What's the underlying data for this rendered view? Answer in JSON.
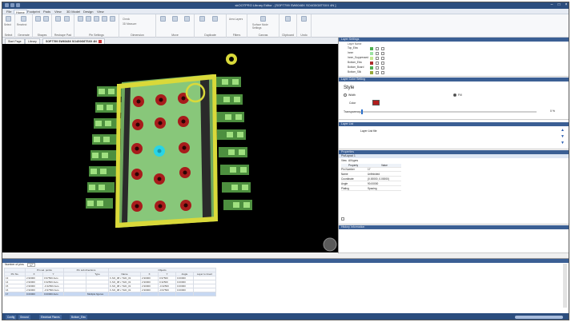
{
  "window": {
    "title": "skOOTPRO Library Editor - [SOP7799 SW6048X SO4G0G8TSXX 4N ]",
    "min_glyph": "–",
    "max_glyph": "□",
    "close_glyph": "×"
  },
  "menubar": {
    "items": [
      "File",
      "Home",
      "Footprint",
      "Pads",
      "View",
      "3D Model",
      "Design",
      "View"
    ]
  },
  "ribbon": {
    "groups": [
      {
        "label": "Select",
        "items": [
          "Select",
          "Reselect"
        ]
      },
      {
        "label": "Generate",
        "items": []
      },
      {
        "label": "Shapes",
        "items": [
          "Start Page",
          "Library"
        ]
      },
      {
        "label": "Reshape Pad",
        "items": []
      },
      {
        "label": "Pin Settings",
        "items": []
      },
      {
        "label": "Dimension",
        "items": [
          "Check",
          "3D Measure"
        ]
      },
      {
        "label": "Move",
        "items": []
      },
      {
        "label": "Duplicate",
        "items": []
      },
      {
        "label": "Filters",
        "items": [
          "Area Layers"
        ]
      },
      {
        "label": "Canvas",
        "items": [
          "Surface Mode",
          "Settings"
        ]
      },
      {
        "label": "Clipboard",
        "items": []
      },
      {
        "label": "Undo",
        "items": []
      }
    ]
  },
  "doc_tabs": [
    "Start Page",
    "Library",
    "SOP7799 SW6048X SO4G0G8TSXX 4N"
  ],
  "layers_panel": {
    "title": "Layer Settings",
    "columns": [
      "Layer Name"
    ],
    "rows": [
      {
        "name": "Top_Elec",
        "color": "#4fae4f"
      },
      {
        "name": "Inner",
        "color": "#9be3a2"
      },
      {
        "name": "Inner_Suppressed",
        "color": "#c4e890"
      },
      {
        "name": "Bottom_Elec",
        "color": "#ad2b2b"
      },
      {
        "name": "Bottom_Board",
        "color": "#4fae4f"
      },
      {
        "name": "Bottom_Silk",
        "color": "#96a83a"
      }
    ]
  },
  "color_panel": {
    "title": "Layer Color Setting",
    "style_label": "Style",
    "opt_a": "Width",
    "opt_b": "Fill",
    "color_label": "Color",
    "transparency_label": "Transparency",
    "transparency_value": "0 %",
    "swatch": "#b21c1c"
  },
  "layer_list_panel": {
    "title": "Layer List",
    "item": "Layer List file"
  },
  "properties_panel": {
    "title": "Properties",
    "subtitle": "Pin/Layout 1",
    "view_label": "View",
    "view_value": "All types",
    "columns": [
      "Property",
      "Value"
    ],
    "rows": [
      {
        "property": "Pin Number",
        "value": "17"
      },
      {
        "property": "Name",
        "value": "Unfinished"
      },
      {
        "property": "Coordinate",
        "value": "(0.00000, 0.00000)"
      },
      {
        "property": "Angle",
        "value": "90.00000"
      },
      {
        "property": "Plating",
        "value": "Spacing"
      }
    ]
  },
  "history_panel": {
    "title": "History Information"
  },
  "bottom_panel": {
    "label": "Number of pins",
    "value": "17",
    "headers_top": [
      "",
      "Pin sel. points",
      "",
      "Pin sub directions",
      "",
      "Objects",
      "",
      "",
      "",
      ""
    ],
    "headers": [
      "Pin No.",
      "X",
      "Y",
      "",
      "Type",
      "Name",
      "X",
      "Y",
      "Angle",
      "Layer to Insert"
    ],
    "rows": [
      [
        "13",
        "2.90000",
        "0.97500 Auto",
        "",
        "",
        "F-SO_08 x THD_01",
        "2.90000",
        "0.97500",
        "0.00000",
        ""
      ],
      [
        "14",
        "2.90000",
        "0.32500 Auto",
        "",
        "",
        "F-SO_08 x THD_01",
        "2.90000",
        "0.32500",
        "0.00000",
        ""
      ],
      [
        "15",
        "2.90000",
        "-0.32500 Auto",
        "",
        "",
        "F-SO_08 x THD_01",
        "2.90000",
        "-0.32500",
        "0.00000",
        ""
      ],
      [
        "16",
        "2.90000",
        "-0.97500 Auto",
        "",
        "",
        "F-SO_08 x THD_01",
        "2.90000",
        "-0.97500",
        "0.00000",
        ""
      ],
      [
        "17",
        "0.00000",
        "0.00000 Auto",
        "",
        "Multiple figures",
        "",
        "",
        "",
        "",
        ""
      ]
    ]
  },
  "status_tabs": [
    "Config",
    "Ground",
    "Electrical Planes",
    "Bottom_Elec"
  ],
  "colors": {
    "board": "#88c77a",
    "pad_outer": "#4d8f3f",
    "pad_inner": "#9fe07f",
    "silk": "#d9d93a",
    "hole": "#a81c1c",
    "selected_hole": "#29d4e6"
  }
}
